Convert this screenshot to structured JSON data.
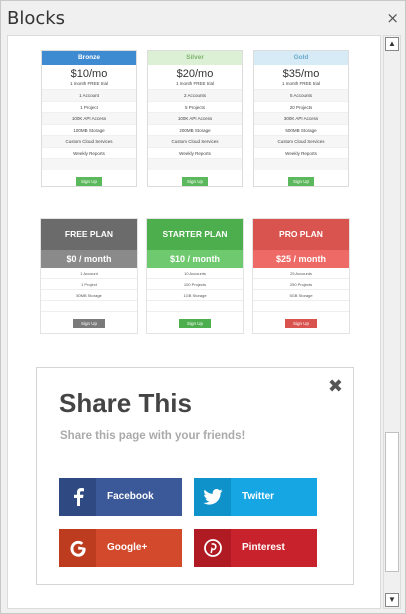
{
  "window": {
    "title": "Blocks",
    "close_glyph": "×"
  },
  "pricing_simple": [
    {
      "name": "Bronze",
      "price": "$10/mo",
      "trial": "1 month FREE trial",
      "header_color": "#3e8bd2",
      "header_text_color": "#ffffff",
      "features": [
        "1 Account",
        "1 Project",
        "100K API Access",
        "100MB Storage",
        "Custom Cloud Services",
        "Weekly Reports"
      ],
      "button": "Sign Up"
    },
    {
      "name": "Silver",
      "price": "$20/mo",
      "trial": "1 month FREE trial",
      "header_color": "#dcf0d6",
      "header_text_color": "#7fb36f",
      "features": [
        "2 Accounts",
        "5 Projects",
        "100K API Access",
        "200MB Storage",
        "Custom Cloud Services",
        "Weekly Reports"
      ],
      "button": "Sign Up"
    },
    {
      "name": "Gold",
      "price": "$35/mo",
      "trial": "1 month FREE trial",
      "header_color": "#d7ebf6",
      "header_text_color": "#6aa8cb",
      "features": [
        "5 Accounts",
        "20 Projects",
        "300K API Access",
        "500MB Storage",
        "Custom Cloud Services",
        "Weekly Reports"
      ],
      "button": "Sign Up"
    }
  ],
  "pricing_plans": [
    {
      "name": "FREE PLAN",
      "price": "$0 / month",
      "head_color": "#6b6b6b",
      "price_color": "#8a8a8a",
      "btn_color": "#7a7a7a",
      "features": [
        "1 Account",
        "1 Project",
        "50MB Storage"
      ],
      "button": "Sign Up"
    },
    {
      "name": "STARTER PLAN",
      "price": "$10 / month",
      "head_color": "#4cae4c",
      "price_color": "#6fca6f",
      "btn_color": "#4cae4c",
      "features": [
        "10 Accounts",
        "100 Projects",
        "1GB Storage"
      ],
      "button": "Sign Up"
    },
    {
      "name": "PRO PLAN",
      "price": "$25 / month",
      "head_color": "#d9534f",
      "price_color": "#ed6a66",
      "btn_color": "#d9534f",
      "features": [
        "25 Accounts",
        "250 Projects",
        "5GB Storage"
      ],
      "button": "Sign Up"
    }
  ],
  "share": {
    "title": "Share This",
    "subtitle": "Share this page with your friends!",
    "close_glyph": "✖",
    "buttons": [
      {
        "label": "Facebook",
        "icon": "facebook-icon",
        "color": "#3b5998",
        "icon_bg": "#2f4a82"
      },
      {
        "label": "Twitter",
        "icon": "twitter-icon",
        "color": "#16a6e4",
        "icon_bg": "#0f92ca"
      },
      {
        "label": "Google+",
        "icon": "google-plus-icon",
        "color": "#d3492c",
        "icon_bg": "#bd3b1f"
      },
      {
        "label": "Pinterest",
        "icon": "pinterest-icon",
        "color": "#c8232c",
        "icon_bg": "#b01a22"
      }
    ]
  },
  "scrollbar": {
    "up": "▲",
    "down": "▼"
  }
}
